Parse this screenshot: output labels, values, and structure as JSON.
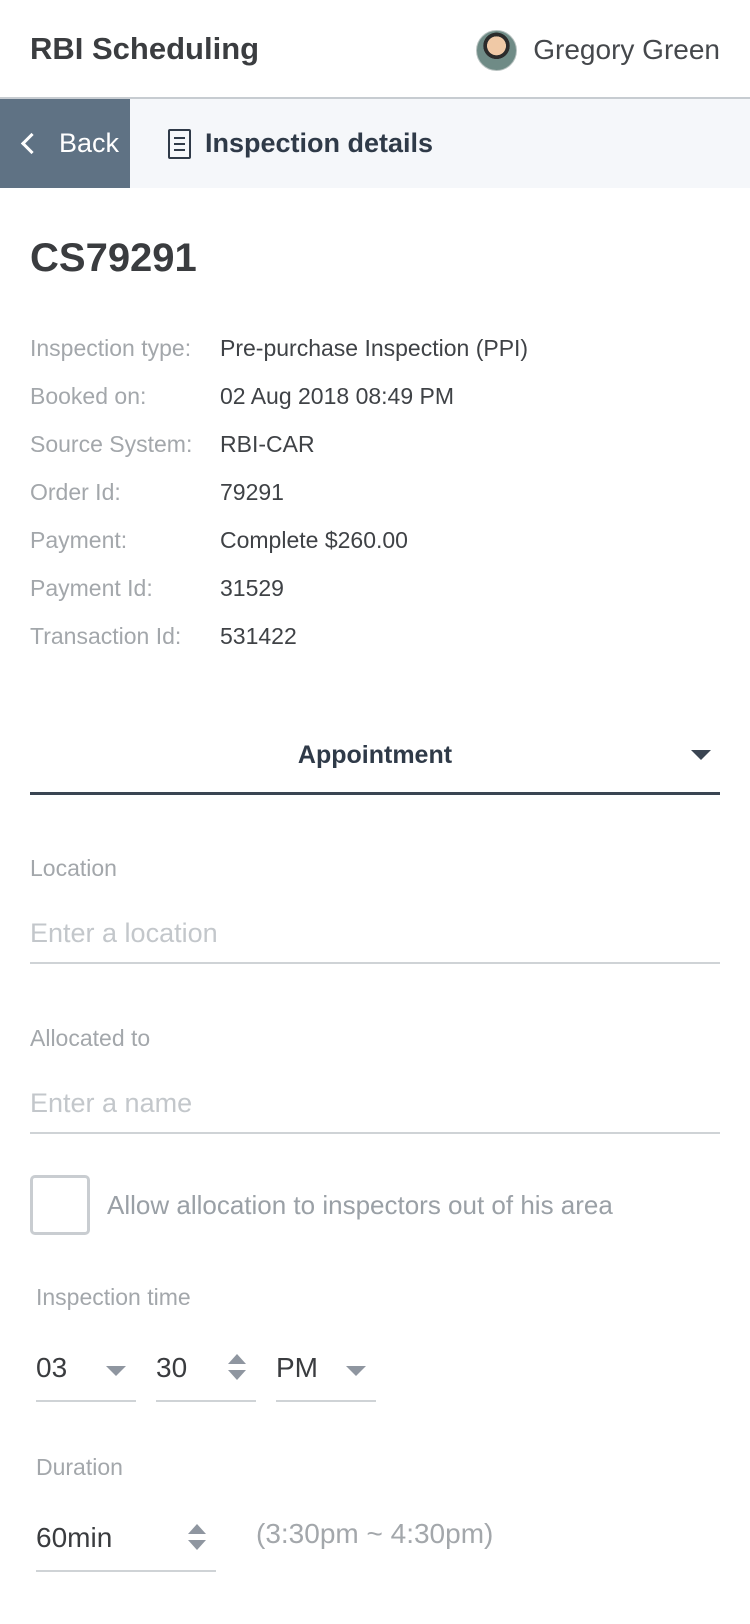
{
  "header": {
    "app_title": "RBI Scheduling",
    "user_name": "Gregory Green"
  },
  "nav": {
    "back_label": "Back",
    "title": "Inspection details"
  },
  "order": {
    "id": "CS79291",
    "details": [
      {
        "label": "Inspection type:",
        "value": "Pre-purchase Inspection (PPI)"
      },
      {
        "label": "Booked on:",
        "value": "02 Aug 2018 08:49 PM"
      },
      {
        "label": "Source System:",
        "value": "RBI-CAR"
      },
      {
        "label": "Order Id:",
        "value": "79291"
      },
      {
        "label": "Payment:",
        "value": "Complete $260.00"
      },
      {
        "label": "Payment Id:",
        "value": "31529"
      },
      {
        "label": "Transaction Id:",
        "value": "531422"
      }
    ]
  },
  "appointment": {
    "section_title": "Appointment",
    "location": {
      "label": "Location",
      "value": "",
      "placeholder": "Enter a location"
    },
    "allocated": {
      "label": "Allocated to",
      "value": "",
      "placeholder": "Enter a name"
    },
    "allow_out_of_area": {
      "label": "Allow allocation to inspectors out of his area",
      "checked": false
    },
    "inspection_time": {
      "label": "Inspection time",
      "hour": "03",
      "minute": "30",
      "ampm": "PM"
    },
    "duration": {
      "label": "Duration",
      "value": "60min",
      "range": "(3:30pm ~ 4:30pm)"
    }
  },
  "colors": {
    "back_button_bg": "#5f7284",
    "nav_bg": "#f5f7fa",
    "accent_dark": "#2f3a48"
  },
  "icons": [
    "chevron-left-icon",
    "document-icon",
    "caret-down-icon",
    "spinner-icon"
  ]
}
